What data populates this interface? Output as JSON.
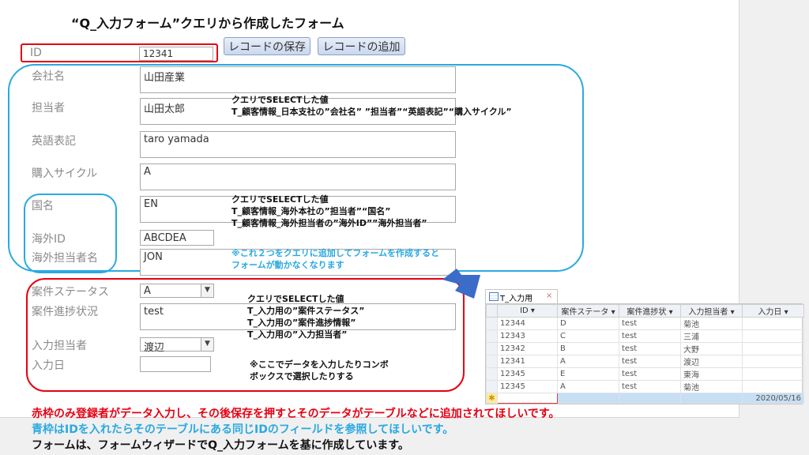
{
  "title": "“Q_入力フォーム”クエリから作成したフォーム",
  "buttons": {
    "save": "レコードの保存",
    "add": "レコードの追加"
  },
  "fields": {
    "id": {
      "label": "ID",
      "value": "12341"
    },
    "company": {
      "label": "会社名",
      "value": "山田産業"
    },
    "person": {
      "label": "担当者",
      "value": "山田太郎"
    },
    "english": {
      "label": "英語表記",
      "value": "taro yamada"
    },
    "cycle": {
      "label": "購入サイクル",
      "value": "A"
    },
    "country": {
      "label": "国名",
      "value": "EN"
    },
    "overseas_id": {
      "label": "海外ID",
      "value": "ABCDEA"
    },
    "overseas_person": {
      "label": "海外担当者名",
      "value": "JON"
    },
    "status": {
      "label": "案件ステータス",
      "value": "A"
    },
    "progress": {
      "label": "案件進捗状況",
      "value": "test"
    },
    "input_person": {
      "label": "入力担当者",
      "value": "渡辺"
    },
    "input_date": {
      "label": "入力日",
      "value": ""
    }
  },
  "annotations": {
    "a1": [
      "クエリでSELECTした値",
      "T_顧客情報_日本支社の”会社名” ”担当者”“英語表記”“購入サイクル”"
    ],
    "a2": [
      "クエリでSELECTした値",
      "T_顧客情報_海外本社の”担当者”“国名”",
      "T_顧客情報_海外担当者の”海外ID””海外担当者”"
    ],
    "a3": [
      "※これ２つをクエリに追加してフォームを作成すると",
      "フォームが動かなくなります"
    ],
    "a4": [
      "クエリでSELECTした値",
      "T_入力用の”案件ステータス”",
      "T_入力用の”案件進捗情報”",
      "T_入力用の”入力担当者”"
    ],
    "a5": [
      "※ここでデータを入力したりコンボ",
      "ボックスで選択したりする"
    ]
  },
  "datasheet": {
    "tab": "T_入力用",
    "close_icon": "×",
    "headers": [
      "ID ▾",
      "案件ステータ ▾",
      "案件進捗状 ▾",
      "入力担当者 ▾",
      "入力日 ▾"
    ],
    "rows": [
      [
        "12344",
        "D",
        "test",
        "菊池",
        ""
      ],
      [
        "12343",
        "C",
        "test",
        "三浦",
        ""
      ],
      [
        "12342",
        "B",
        "test",
        "大野",
        ""
      ],
      [
        "12341",
        "A",
        "test",
        "渡辺",
        ""
      ],
      [
        "12345",
        "E",
        "test",
        "東海",
        ""
      ],
      [
        "12345",
        "A",
        "test",
        "菊池",
        ""
      ]
    ],
    "new_row": [
      "",
      "",
      "",
      "",
      "2020/05/16"
    ],
    "new_row_marker": "✱"
  },
  "footer": [
    "赤枠のみ登録者がデータ入力し、その後保存を押すとそのデータがテーブルなどに追加されてほしいです。",
    "青枠はIDを入れたらそのテーブルにある同じIDのフィールドを参照してほしいです。",
    "フォームは、フォームウィザードでQ_入力フォームを基に作成しています。"
  ],
  "colors": {
    "red": "#e60012",
    "blue": "#29a9e1",
    "arrow": "#3a6cc8"
  }
}
